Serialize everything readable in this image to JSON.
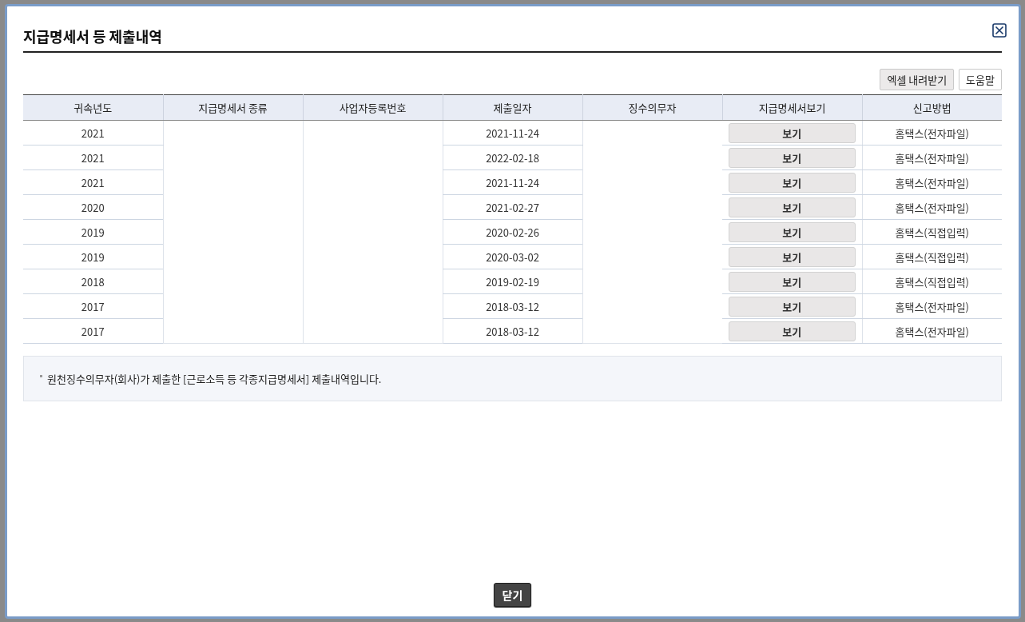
{
  "dialog": {
    "title": "지급명세서 등 제출내역"
  },
  "toolbar": {
    "buttons": [
      "엑셀 내려받기",
      "도움말"
    ]
  },
  "table": {
    "columns": [
      "귀속년도",
      "지급명세서 종류",
      "사업자등록번호",
      "제출일자",
      "징수의무자",
      "지급명세서보기",
      "신고방법"
    ],
    "rows": [
      {
        "year": "2021",
        "date": "2021-11-24",
        "view": "보기",
        "method": "홈택스(전자파일)"
      },
      {
        "year": "2021",
        "date": "2022-02-18",
        "view": "보기",
        "method": "홈택스(전자파일)"
      },
      {
        "year": "2021",
        "date": "2021-11-24",
        "view": "보기",
        "method": "홈택스(전자파일)"
      },
      {
        "year": "2020",
        "date": "2021-02-27",
        "view": "보기",
        "method": "홈택스(전자파일)"
      },
      {
        "year": "2019",
        "date": "2020-02-26",
        "view": "보기",
        "method": "홈택스(직접입력)"
      },
      {
        "year": "2019",
        "date": "2020-03-02",
        "view": "보기",
        "method": "홈택스(직접입력)"
      },
      {
        "year": "2018",
        "date": "2019-02-19",
        "view": "보기",
        "method": "홈택스(직접입력)"
      },
      {
        "year": "2017",
        "date": "2018-03-12",
        "view": "보기",
        "method": "홈택스(전자파일)"
      },
      {
        "year": "2017",
        "date": "2018-03-12",
        "view": "보기",
        "method": "홈택스(전자파일)"
      }
    ]
  },
  "note": "원천징수의무자(회사)가 제출한 [근로소득 등 각종지급명세서] 제출내역입니다.",
  "footer": {
    "close_button": "닫기"
  }
}
